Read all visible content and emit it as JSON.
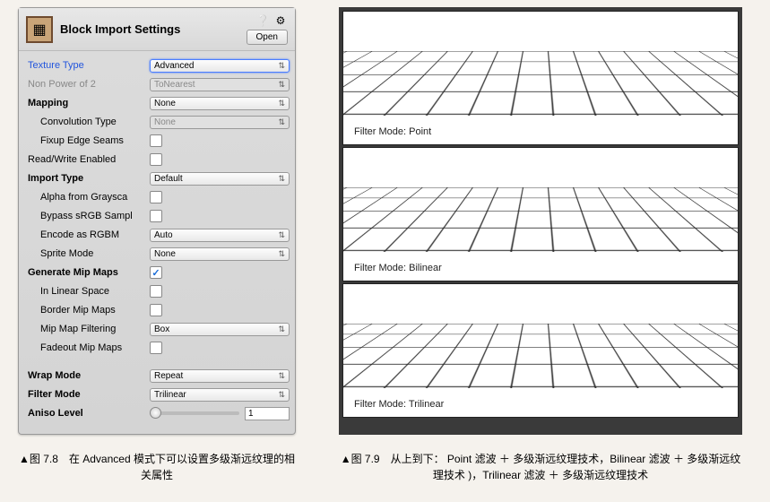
{
  "header": {
    "title": "Block Import Settings",
    "open_btn": "Open"
  },
  "rows": {
    "texture_type": {
      "label": "Texture Type",
      "value": "Advanced"
    },
    "non_power_2": {
      "label": "Non Power of 2",
      "value": "ToNearest"
    },
    "mapping": {
      "label": "Mapping",
      "value": "None"
    },
    "convolution": {
      "label": "Convolution Type",
      "value": "None"
    },
    "fixup_edge": {
      "label": "Fixup Edge Seams"
    },
    "read_write": {
      "label": "Read/Write Enabled"
    },
    "import_type": {
      "label": "Import Type",
      "value": "Default"
    },
    "alpha_gray": {
      "label": "Alpha from Graysca"
    },
    "bypass_srgb": {
      "label": "Bypass sRGB Sampl"
    },
    "encode_rgbm": {
      "label": "Encode as RGBM",
      "value": "Auto"
    },
    "sprite_mode": {
      "label": "Sprite Mode",
      "value": "None"
    },
    "gen_mip": {
      "label": "Generate Mip Maps"
    },
    "linear_space": {
      "label": "In Linear Space"
    },
    "border_mip": {
      "label": "Border Mip Maps"
    },
    "mip_filter": {
      "label": "Mip Map Filtering",
      "value": "Box"
    },
    "fadeout_mip": {
      "label": "Fadeout Mip Maps"
    },
    "wrap_mode": {
      "label": "Wrap Mode",
      "value": "Repeat"
    },
    "filter_mode": {
      "label": "Filter Mode",
      "value": "Trilinear"
    },
    "aniso": {
      "label": "Aniso Level",
      "value": "1"
    }
  },
  "previews": {
    "p1": "Filter Mode: Point",
    "p2": "Filter Mode: Bilinear",
    "p3": "Filter Mode: Trilinear"
  },
  "captions": {
    "left": "▲图 7.8　在 Advanced 模式下可以设置多级渐远纹理的相关属性",
    "right": "▲图 7.9　从上到下： Point 滤波 ＋ 多级渐远纹理技术，Bilinear 滤波 ＋ 多级渐远纹理技术 )，Trilinear 滤波 ＋ 多级渐远纹理技术"
  }
}
